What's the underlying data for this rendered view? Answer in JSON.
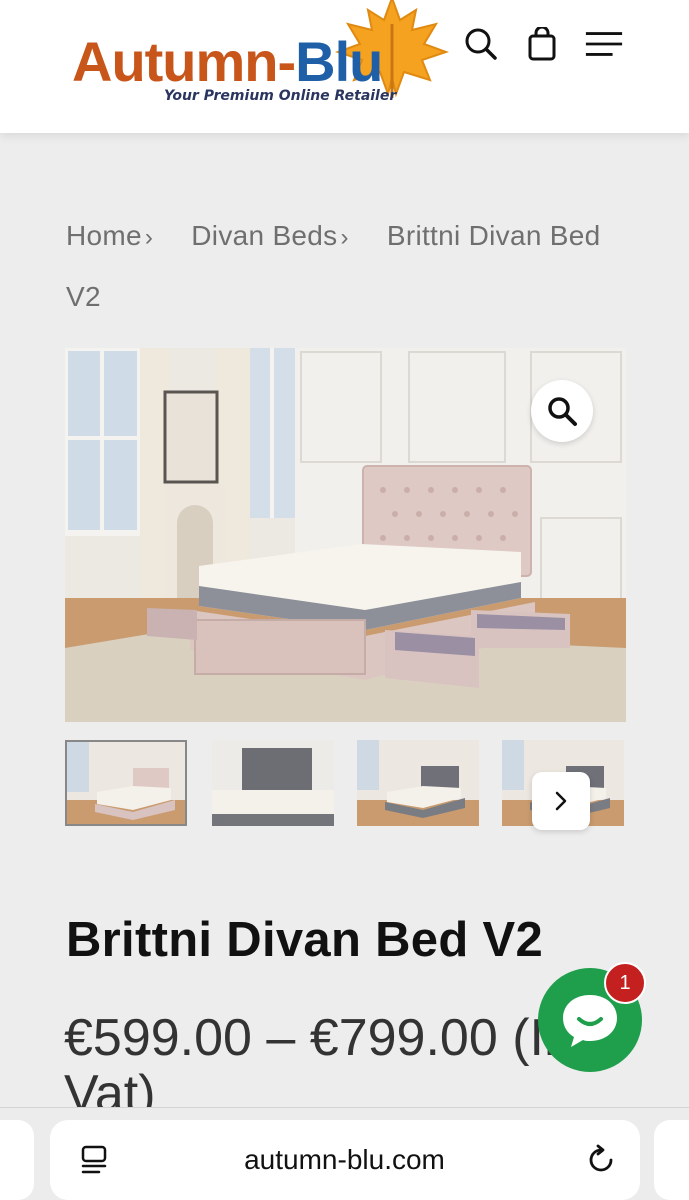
{
  "brand": {
    "name_part1": "Autumn-",
    "name_part2": "Blu",
    "tagline": "Your Premium Online Retailer"
  },
  "header": {
    "icons": [
      "search-icon",
      "shopping-bag-icon",
      "menu-icon"
    ]
  },
  "breadcrumb": {
    "items": [
      "Home",
      "Divan Beds",
      "Brittni Divan Bed V2"
    ],
    "separator": "›"
  },
  "gallery": {
    "thumbnail_count": 4,
    "active_index": 0
  },
  "product": {
    "title": "Brittni Divan Bed V2",
    "price": "€599.00 – €799.00 (Inc Vat)"
  },
  "chat": {
    "badge_count": "1"
  },
  "browser": {
    "url": "autumn-blu.com"
  },
  "colors": {
    "brand_orange": "#c8561b",
    "brand_blue": "#1f5fa8",
    "chat_green": "#1f9f4c",
    "badge_red": "#c4201f"
  }
}
